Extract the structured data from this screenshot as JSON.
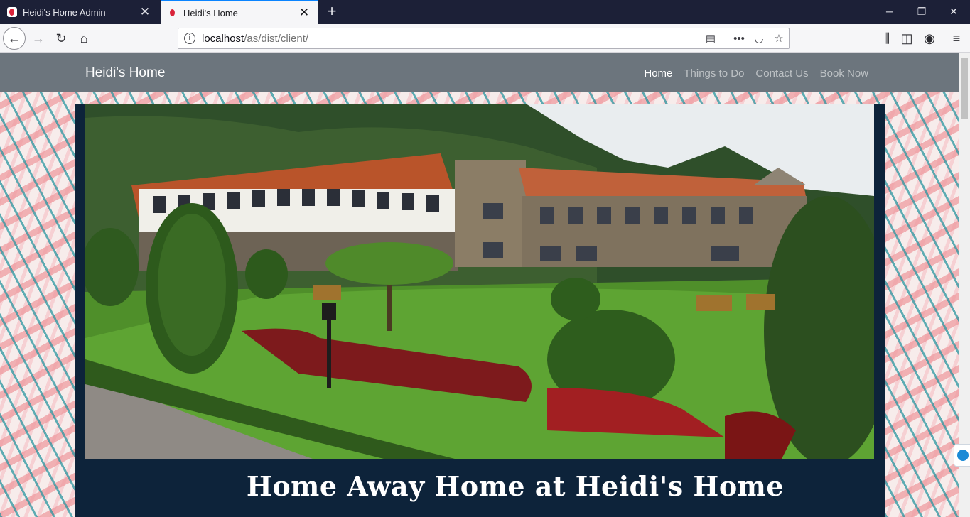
{
  "browser": {
    "tabs": [
      {
        "title": "Heidi's Home Admin",
        "active": false
      },
      {
        "title": "Heidi's Home",
        "active": true
      }
    ],
    "url_host": "localhost",
    "url_path": "/as/dist/client/"
  },
  "site": {
    "brand": "Heidi's Home",
    "nav": [
      {
        "label": "Home",
        "active": true
      },
      {
        "label": "Things to Do",
        "active": false
      },
      {
        "label": "Contact Us",
        "active": false
      },
      {
        "label": "Book Now",
        "active": false
      }
    ],
    "headline": "Home Away Home at Heidi's Home"
  },
  "colors": {
    "site_nav_bg": "#6c757d",
    "panel_bg": "#0d233a",
    "tab_accent": "#0a84ff"
  }
}
